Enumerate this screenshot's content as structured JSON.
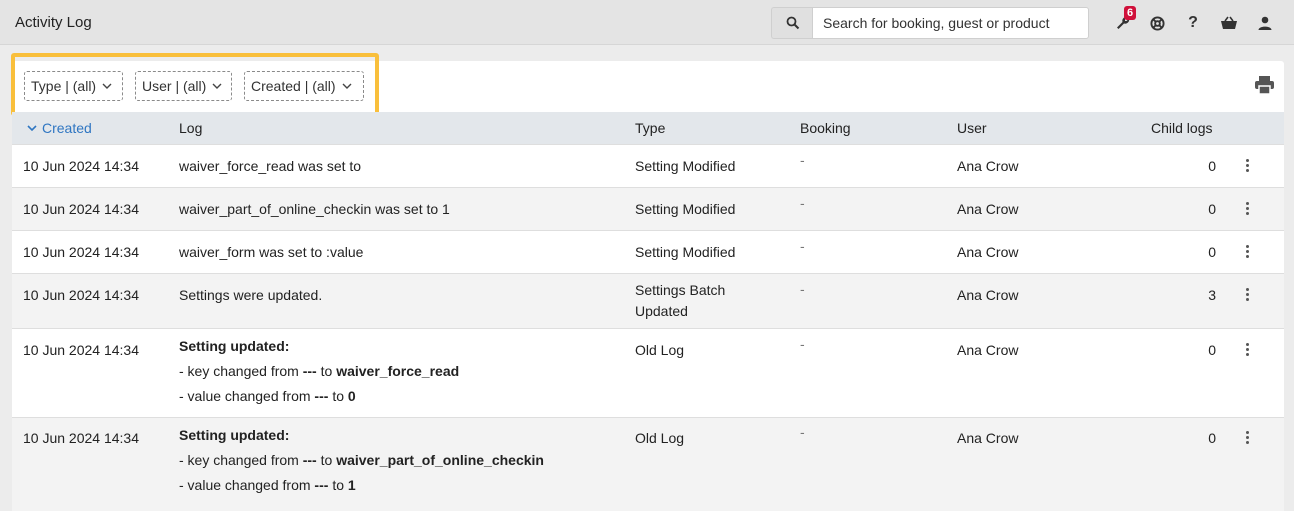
{
  "header": {
    "title": "Activity Log",
    "search_placeholder": "Search for booking, guest or product",
    "notification_count": "6",
    "icons": [
      "search-icon",
      "wrench-icon",
      "support-icon",
      "help-icon",
      "basket-icon",
      "user-icon"
    ]
  },
  "filters": [
    {
      "label": "Type | (all)"
    },
    {
      "label": "User | (all)"
    },
    {
      "label": "Created | (all)"
    }
  ],
  "accent_color": "#f9bf3b",
  "table": {
    "columns": {
      "created": "Created",
      "log": "Log",
      "type": "Type",
      "booking": "Booking",
      "user": "User",
      "child_logs": "Child logs"
    },
    "rows": [
      {
        "created": "10 Jun 2024 14:34",
        "log": "waiver_force_read was set to",
        "type": "Setting Modified",
        "booking": "-",
        "user": "Ana Crow",
        "child_logs": "0"
      },
      {
        "created": "10 Jun 2024 14:34",
        "log": "waiver_part_of_online_checkin was set to 1",
        "type": "Setting Modified",
        "booking": "-",
        "user": "Ana Crow",
        "child_logs": "0"
      },
      {
        "created": "10 Jun 2024 14:34",
        "log": "waiver_form was set to :value",
        "type": "Setting Modified",
        "booking": "-",
        "user": "Ana Crow",
        "child_logs": "0"
      },
      {
        "created": "10 Jun 2024 14:34",
        "log": "Settings were updated.",
        "type_line1": "Settings Batch",
        "type_line2": "Updated",
        "booking": "-",
        "user": "Ana Crow",
        "child_logs": "3"
      },
      {
        "created": "10 Jun 2024 14:34",
        "log_title": "Setting updated:",
        "log_key_prefix": "- key changed from",
        "log_key_from": "---",
        "log_to": "to",
        "log_key_to": "waiver_force_read",
        "log_value_prefix": "- value changed from",
        "log_value_from": "---",
        "log_value_to": "0",
        "type": "Old Log",
        "booking": "-",
        "user": "Ana Crow",
        "child_logs": "0"
      },
      {
        "created": "10 Jun 2024 14:34",
        "log_title": "Setting updated:",
        "log_key_prefix": "- key changed from",
        "log_key_from": "---",
        "log_to": "to",
        "log_key_to": "waiver_part_of_online_checkin",
        "log_value_prefix": "- value changed from",
        "log_value_from": "---",
        "log_value_to": "1",
        "type": "Old Log",
        "booking": "-",
        "user": "Ana Crow",
        "child_logs": "0"
      }
    ]
  }
}
